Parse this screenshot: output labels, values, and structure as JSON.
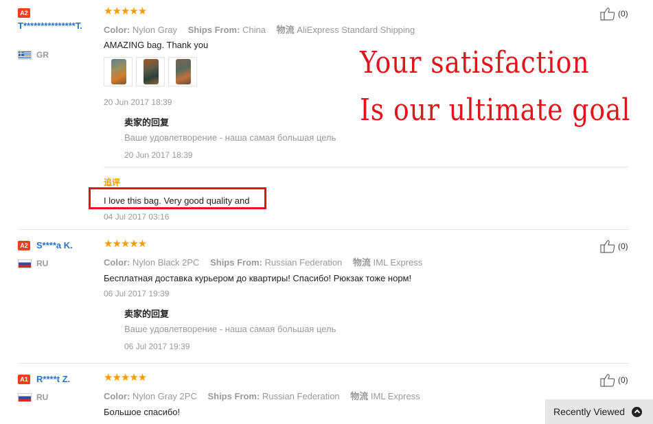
{
  "reviews": [
    {
      "level": "A2",
      "user": "T***************T.",
      "country": "GR",
      "stars": "★★★★★",
      "color_label": "Color:",
      "color_value": "Nylon Gray",
      "ships_label": "Ships From:",
      "ships_value": "China",
      "logistics_label": "物流",
      "logistics_value": "AliExpress Standard Shipping",
      "text": "AMAZING bag. Thank you",
      "date": "20 Jun 2017 18:39",
      "reply_title": "卖家的回复",
      "reply_text": "Ваше удовлетворение - наша самая большая цель",
      "reply_date": "20 Jun 2017 18:39",
      "followup_label": "追评",
      "followup_text": "I love this bag. Very good quality and",
      "followup_date": "04 Jul 2017 03:16",
      "likes": "(0)"
    },
    {
      "level": "A2",
      "user": "S****a K.",
      "country": "RU",
      "stars": "★★★★★",
      "color_label": "Color:",
      "color_value": "Nylon Black 2PC",
      "ships_label": "Ships From:",
      "ships_value": "Russian Federation",
      "logistics_label": "物流",
      "logistics_value": "IML Express",
      "text": "Бесплатная доставка курьером до квартиры! Спасибо! Рюкзак тоже норм!",
      "date": "06 Jul 2017 19:39",
      "reply_title": "卖家的回复",
      "reply_text": "Ваше удовлетворение - наша самая большая цель",
      "reply_date": "06 Jul 2017 19:39",
      "likes": "(0)"
    },
    {
      "level": "A1",
      "user": "R****t Z.",
      "country": "RU",
      "stars": "★★★★★",
      "color_label": "Color:",
      "color_value": "Nylon Gray 2PC",
      "ships_label": "Ships From:",
      "ships_value": "Russian Federation",
      "logistics_label": "物流",
      "logistics_value": "IML Express",
      "text": "Большое спасибо!",
      "likes": "(0)"
    }
  ],
  "overlay": {
    "line1": "Your satisfaction",
    "line2": "Is our ultimate goal"
  },
  "recently_viewed": "Recently Viewed",
  "colors": {
    "accent_red": "#e0151b",
    "star_orange": "#ff9a00",
    "username_blue": "#2673c7",
    "level_badge": "#e8421f"
  }
}
